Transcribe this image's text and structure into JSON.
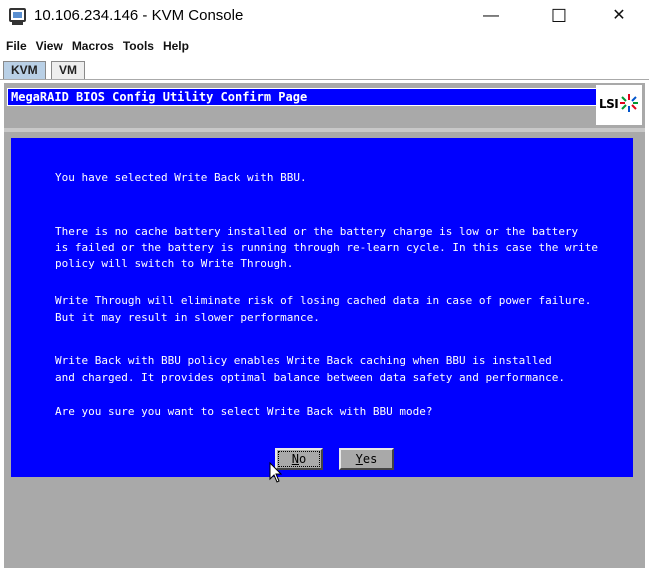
{
  "window": {
    "title": "10.106.234.146 - KVM Console",
    "minimize_glyph": "—",
    "maximize_glyph": "☐",
    "close_glyph": "✕"
  },
  "menubar": [
    "File",
    "View",
    "Macros",
    "Tools",
    "Help"
  ],
  "tabs": [
    {
      "label": "KVM",
      "active": true
    },
    {
      "label": "VM",
      "active": false
    }
  ],
  "bios": {
    "header": "MegaRAID BIOS Config Utility Confirm Page",
    "logo_text": "LSI",
    "colors": {
      "background": "#0000ff",
      "text": "#ffffff",
      "frame": "#a9a9a9"
    },
    "lines": [
      "You have selected Write Back with BBU.",
      "There is no cache battery installed or the battery charge is low or the battery",
      "is failed or the battery is running through re-learn cycle. In this case the write",
      "policy will switch to Write Through.",
      "Write Through will eliminate risk of losing cached data in case of power failure.",
      "But it may result in slower performance.",
      "Write Back with BBU policy enables Write Back caching when BBU is installed",
      "and charged. It provides optimal balance between data safety and performance.",
      "Are you sure you want to select Write Back with BBU mode?"
    ],
    "buttons": {
      "no": {
        "hotkey": "N",
        "rest": "o"
      },
      "yes": {
        "hotkey": "Y",
        "rest": "es"
      }
    }
  }
}
